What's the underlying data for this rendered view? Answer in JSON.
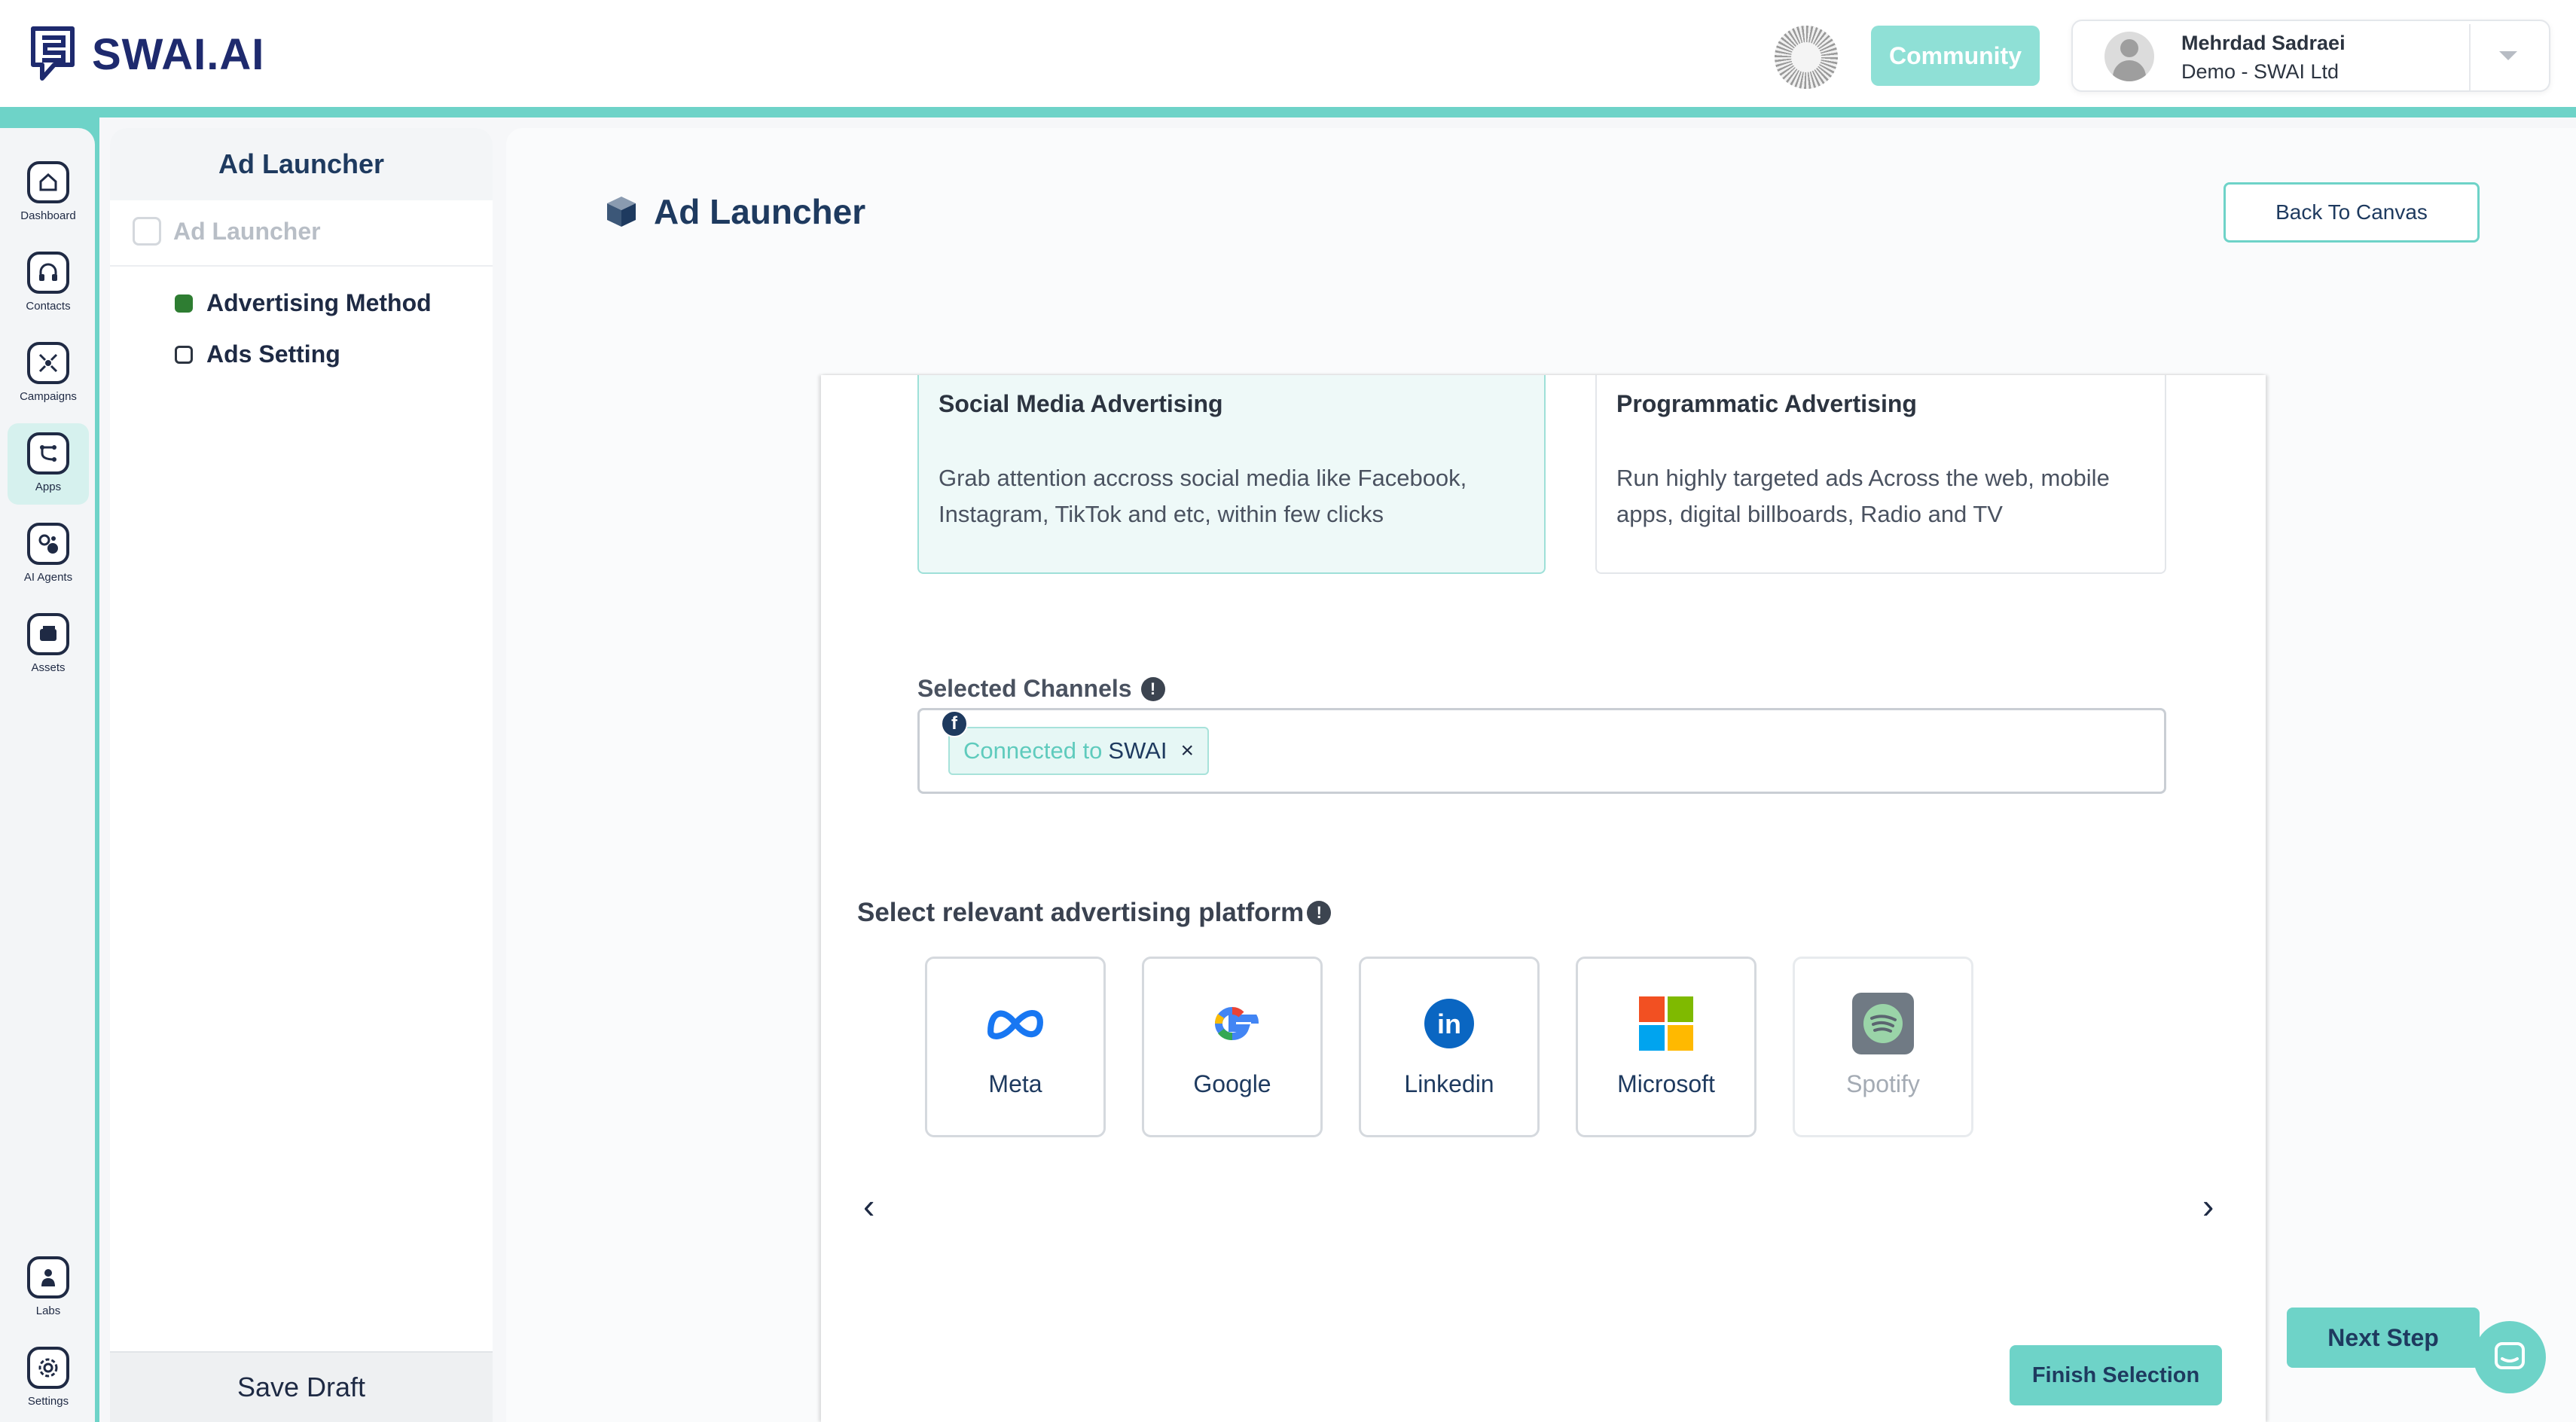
{
  "header": {
    "brand": "SWAI.AI",
    "community_label": "Community",
    "user_name": "Mehrdad Sadraei",
    "user_org": "Demo - SWAI Ltd"
  },
  "rail": {
    "items": [
      {
        "label": "Dashboard",
        "icon": "home-icon"
      },
      {
        "label": "Contacts",
        "icon": "headset-icon"
      },
      {
        "label": "Campaigns",
        "icon": "target-icon"
      },
      {
        "label": "Apps",
        "icon": "apps-icon",
        "active": true
      },
      {
        "label": "AI Agents",
        "icon": "ai-agents-icon"
      },
      {
        "label": "Assets",
        "icon": "assets-icon"
      },
      {
        "label": "Labs",
        "icon": "labs-icon"
      },
      {
        "label": "Settings",
        "icon": "gear-icon"
      }
    ]
  },
  "sidebar": {
    "title": "Ad Launcher",
    "root_label": "Ad Launcher",
    "steps": [
      {
        "label": "Advertising Method",
        "status": "done"
      },
      {
        "label": "Ads Setting",
        "status": "todo"
      }
    ],
    "save_draft": "Save Draft"
  },
  "main": {
    "title": "Ad Launcher",
    "back_button": "Back To Canvas",
    "options": [
      {
        "title": "Social Media Advertising",
        "description": "Grab attention accross social media like Facebook, Instagram, TikTok and etc, within few clicks",
        "selected": true
      },
      {
        "title": "Programmatic Advertising",
        "description": "Run highly targeted ads Across the web, mobile apps, digital billboards, Radio and TV",
        "selected": false
      }
    ],
    "channels_label": "Selected Channels",
    "chip": {
      "status": "Connected to",
      "name": "SWAI",
      "remove": "×"
    },
    "platform_label": "Select relevant advertising platform",
    "platforms": [
      {
        "name": "Meta",
        "icon": "meta-icon",
        "enabled": true
      },
      {
        "name": "Google",
        "icon": "google-icon",
        "enabled": true
      },
      {
        "name": "Linkedin",
        "icon": "linkedin-icon",
        "enabled": true
      },
      {
        "name": "Microsoft",
        "icon": "microsoft-icon",
        "enabled": true
      },
      {
        "name": "Spotify",
        "icon": "spotify-icon",
        "enabled": false
      }
    ],
    "finish_button": "Finish Selection",
    "next_button": "Next Step"
  },
  "colors": {
    "accent": "#6ed3c8",
    "navy": "#1e3a5f",
    "done": "#2e7d32"
  }
}
